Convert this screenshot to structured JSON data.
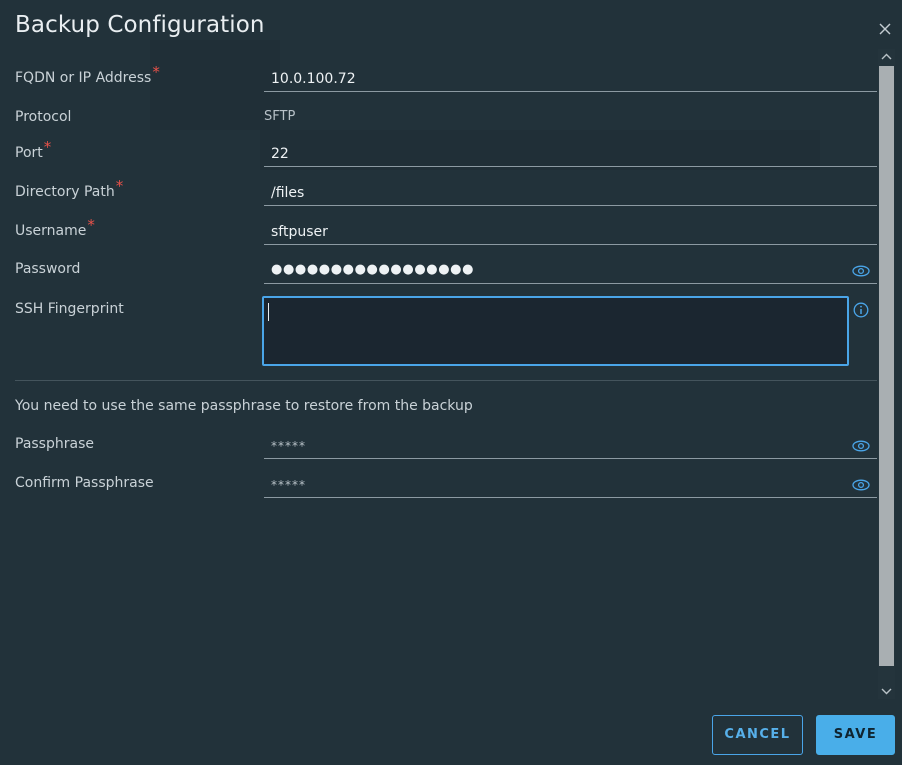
{
  "dialog": {
    "title": "Backup Configuration",
    "close_icon": "close-icon"
  },
  "form": {
    "fqdn": {
      "label": "FQDN or IP Address",
      "required": "*",
      "value": "10.0.100.72"
    },
    "protocol": {
      "label": "Protocol",
      "value": "SFTP"
    },
    "port": {
      "label": "Port",
      "required": "*",
      "value": "22"
    },
    "directory": {
      "label": "Directory Path",
      "required": "*",
      "value": "/files"
    },
    "username": {
      "label": "Username",
      "required": "*",
      "value": "sftpuser"
    },
    "password": {
      "label": "Password",
      "value": "●●●●●●●●●●●●●●●●●",
      "icon": "eye-icon"
    },
    "fingerprint": {
      "label": "SSH Fingerprint",
      "value": "",
      "icon": "info-icon"
    },
    "note": "You need to use the same passphrase to restore from the backup",
    "passphrase": {
      "label": "Passphrase",
      "value": "*****",
      "icon": "eye-icon"
    },
    "confirm_passphrase": {
      "label": "Confirm Passphrase",
      "value": "*****",
      "icon": "eye-icon"
    }
  },
  "footer": {
    "cancel_label": "CANCEL",
    "save_label": "SAVE"
  },
  "colors": {
    "background": "#22323a",
    "accent": "#49aee9",
    "required": "#e8524a"
  }
}
